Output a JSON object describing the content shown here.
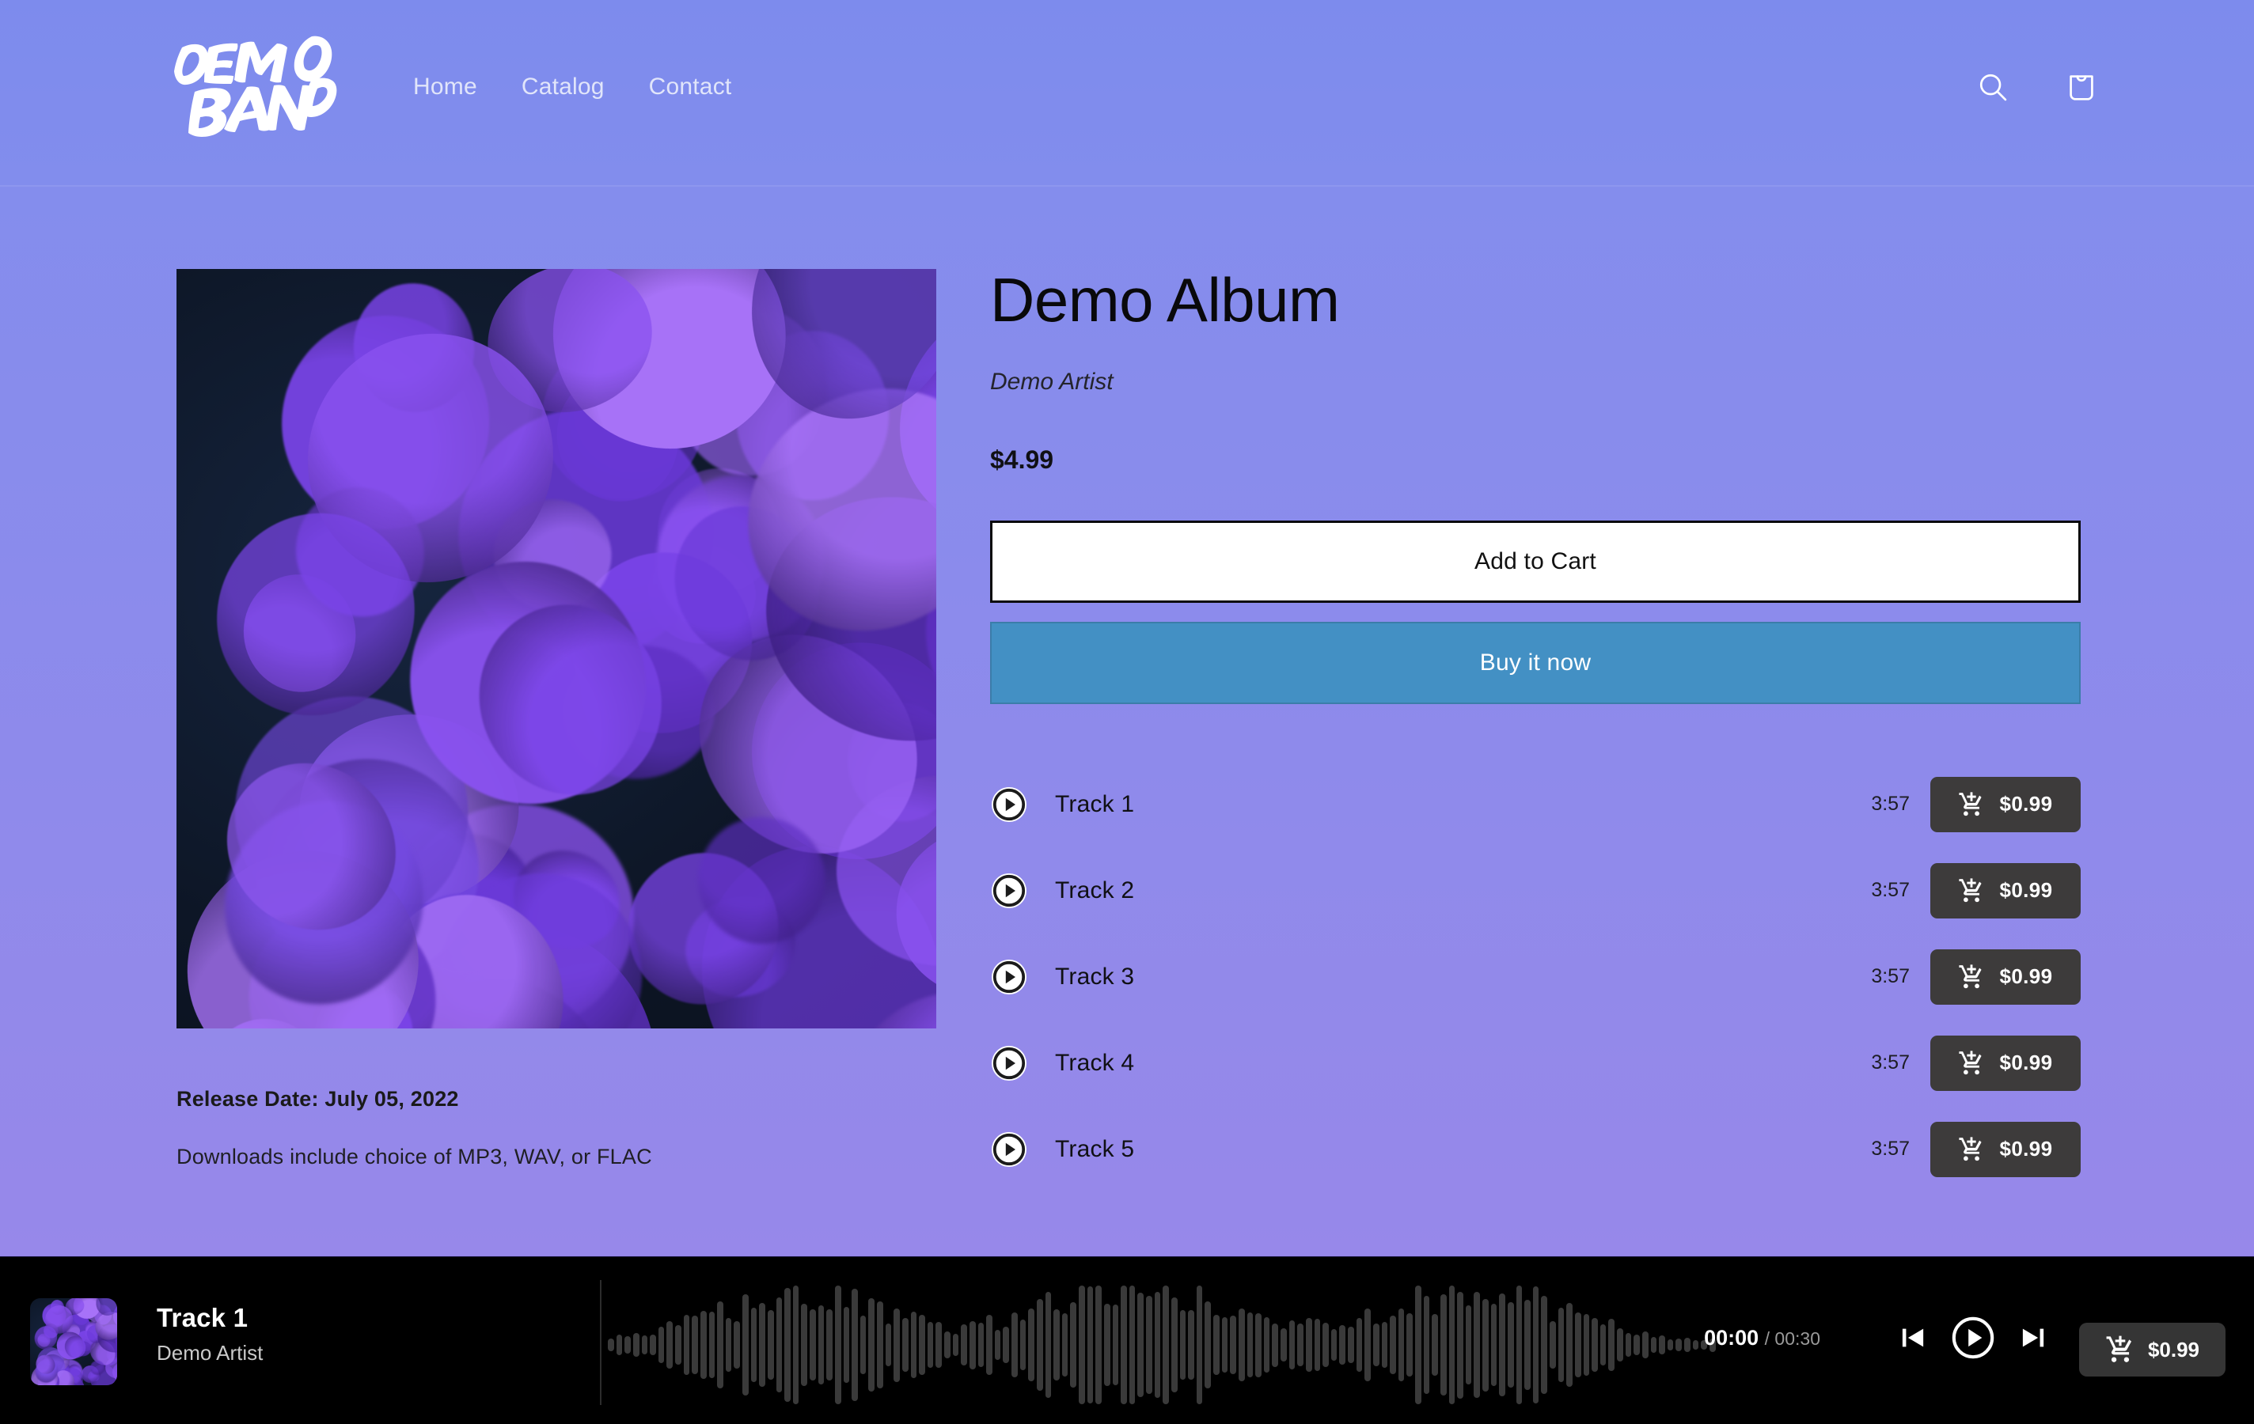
{
  "header": {
    "logo_text": "DEMO BAND",
    "nav": [
      {
        "label": "Home"
      },
      {
        "label": "Catalog"
      },
      {
        "label": "Contact"
      }
    ],
    "search_icon": "search-icon",
    "cart_icon": "shopping-bag-icon"
  },
  "product": {
    "title": "Demo Album",
    "artist": "Demo Artist",
    "price": "$4.99",
    "add_to_cart_label": "Add to Cart",
    "buy_now_label": "Buy it now",
    "release_date": "Release Date: July 05, 2022",
    "download_note": "Downloads include choice of MP3, WAV, or FLAC",
    "album_art_alt": "purple bacteria microscopy album cover"
  },
  "tracks": [
    {
      "title": "Track 1",
      "duration": "3:57",
      "price": "$0.99"
    },
    {
      "title": "Track 2",
      "duration": "3:57",
      "price": "$0.99"
    },
    {
      "title": "Track 3",
      "duration": "3:57",
      "price": "$0.99"
    },
    {
      "title": "Track 4",
      "duration": "3:57",
      "price": "$0.99"
    },
    {
      "title": "Track 5",
      "duration": "3:57",
      "price": "$0.99"
    }
  ],
  "player": {
    "now_playing_title": "Track 1",
    "now_playing_artist": "Demo Artist",
    "current_time": "00:00",
    "total_time": "/ 00:30",
    "price": "$0.99",
    "prev_icon": "skip-previous-icon",
    "play_icon": "play-circle-icon",
    "next_icon": "skip-next-icon",
    "cart_icon": "add-shopping-cart-icon"
  },
  "colors": {
    "page_top": "#7f8ced",
    "page_bottom": "#9a87e9",
    "buy_now": "#4390c4",
    "cart_button": "#3d3b3b",
    "player_bg": "#000000",
    "waveform_bar": "#3a3a3a"
  }
}
